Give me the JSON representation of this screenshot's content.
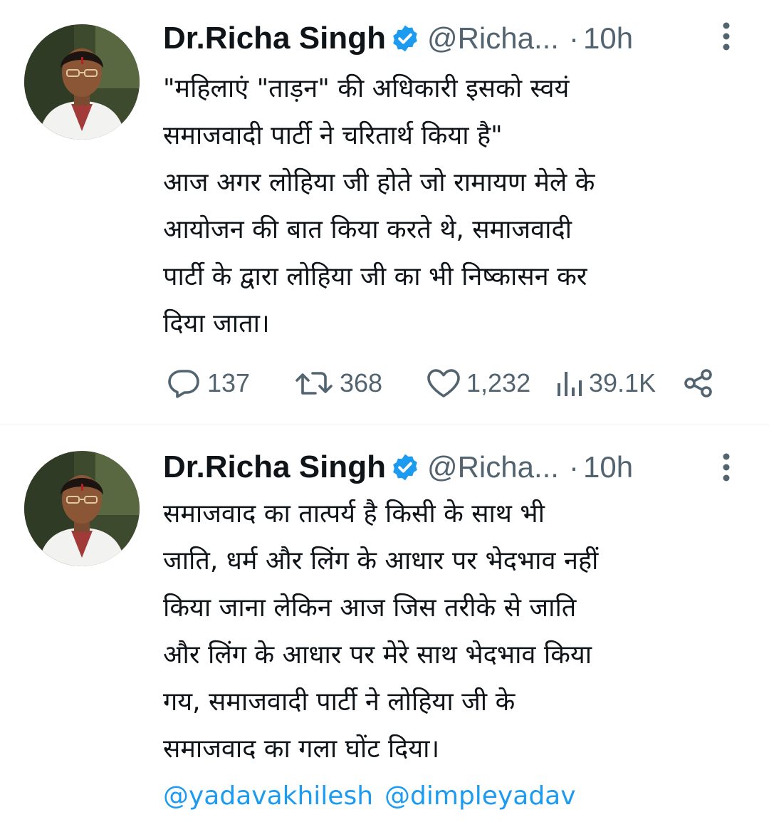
{
  "tweets": [
    {
      "author": {
        "name": "Dr.Richa Singh",
        "handle": "@Richa...",
        "time": "10h",
        "separator": "·",
        "verified": true
      },
      "lines": [
        "\"महिलाएं \"ताड़न\" की अधिकारी इसको स्वयं",
        "समाजवादी पार्टी ने चरितार्थ किया है\"",
        "आज अगर लोहिया जी होते जो रामायण मेले के",
        "आयोजन की बात किया करते थे, समाजवादी",
        "पार्टी के द्वारा लोहिया जी का भी निष्कासन कर",
        "दिया जाता।"
      ],
      "stats": {
        "replies": "137",
        "retweets": "368",
        "likes": "1,232",
        "views": "39.1K"
      }
    },
    {
      "author": {
        "name": "Dr.Richa Singh",
        "handle": "@Richa...",
        "time": "10h",
        "separator": "·",
        "verified": true
      },
      "lines": [
        "समाजवाद का तात्पर्य है किसी के साथ भी",
        "जाति, धर्म और लिंग के आधार पर भेदभाव नहीं",
        "किया जाना लेकिन आज जिस तरीके से जाति",
        "और लिंग के आधार पर मेरे साथ भेदभाव किया",
        "गय, समाजवादी पार्टी ने लोहिया जी के",
        "समाजवाद का गला घोंट दिया।"
      ],
      "mentions": [
        "@yadavakhilesh",
        "@dimpleyadav"
      ]
    }
  ],
  "colors": {
    "text": "#0f1419",
    "secondary": "#536471",
    "accent": "#1d9bf0",
    "divider": "#eff3f4"
  },
  "icons": {
    "reply": "reply-icon",
    "retweet": "retweet-icon",
    "like": "heart-icon",
    "views": "views-icon",
    "share": "share-icon",
    "more": "more-vertical-icon",
    "verified": "verified-badge-icon"
  }
}
